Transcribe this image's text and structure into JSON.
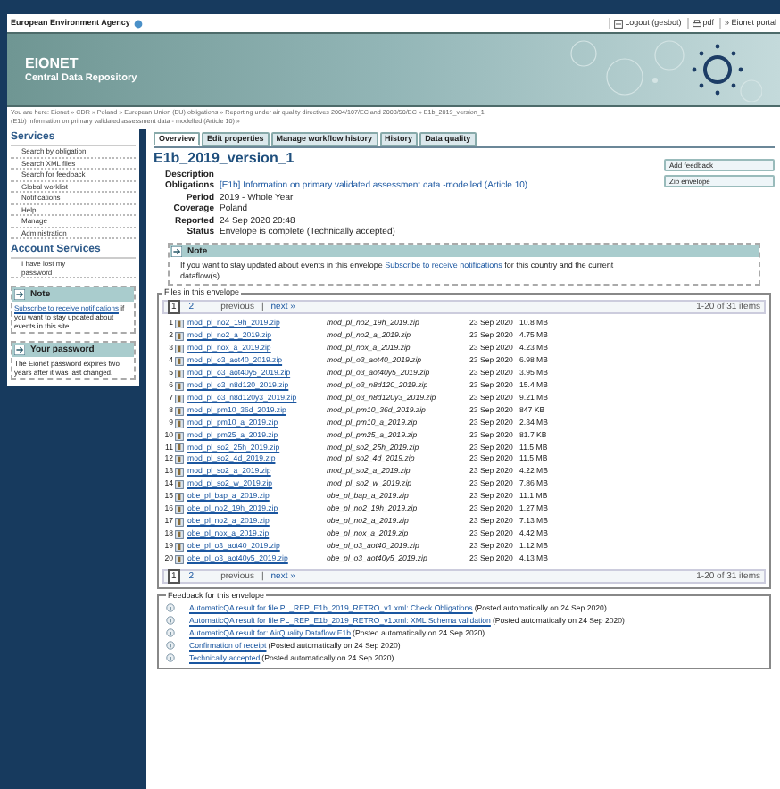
{
  "top_bar": {
    "agency": "European Environment Agency",
    "links": [
      {
        "kind": "logout",
        "label": "Logout (gesbot)"
      },
      {
        "kind": "print",
        "label": "pdf"
      },
      {
        "kind": "portal",
        "label": "» Eionet portal"
      }
    ]
  },
  "header": {
    "title": "EIONET",
    "subtitle": "Central Data Repository"
  },
  "breadcrumb": [
    "You are here: Eionet » CDR » Poland » European Union (EU) obligations » Reporting under air quality directives 2004/107/EC and 2008/50/EC » E1b_2019_version_1",
    "(E1b) Information on primary validated assessment data - modelled (Article 10) »"
  ],
  "sidebar": {
    "services_title": "Services",
    "services": [
      "Search by obligation",
      "Search XML files",
      "Search for feedback",
      "Global worklist",
      "Notifications",
      "Help",
      "Manage",
      "Administration"
    ],
    "account_title": "Account Services",
    "account": [
      "I have lost my password"
    ],
    "boxes": [
      {
        "title": "Note",
        "link": "Subscribe to receive notifications",
        "text": " if you want to stay updated about events in this site."
      },
      {
        "title": "Your password",
        "text": "The Eionet password expires two years after it was last changed."
      }
    ]
  },
  "tabs": [
    {
      "label": "Overview",
      "selected": true
    },
    {
      "label": "Edit properties",
      "selected": false
    },
    {
      "label": "Manage workflow history",
      "selected": false
    },
    {
      "label": "History",
      "selected": false
    },
    {
      "label": "Data quality",
      "selected": false
    }
  ],
  "title": "E1b_2019_version_1",
  "actions": [
    "Add feedback",
    "Zip envelope"
  ],
  "properties": [
    {
      "label": "Description"
    },
    {
      "label": "Obligations",
      "value": "[E1b] Information on primary validated assessment data -modelled (Article 10)",
      "link": true
    },
    {
      "label": "Period",
      "value": "2019 - Whole Year"
    },
    {
      "label": "Coverage",
      "value": "Poland"
    },
    {
      "label": "Reported",
      "value": "24 Sep 2020 20:48"
    },
    {
      "label": "Status",
      "value": "Envelope is complete (Technically accepted)"
    }
  ],
  "note": {
    "title": "Note",
    "before": "If you want to stay updated about events in this envelope ",
    "link": "Subscribe to receive notifications",
    "after": " for this country and the current dataflow(s)."
  },
  "files": {
    "legend": "Files in this envelope",
    "pagination": [
      {
        "pages": [
          {
            "label": "1",
            "selected": true
          },
          {
            "label": "2",
            "selected": false
          }
        ],
        "previous": "previous",
        "separator": "|",
        "next": "next »",
        "count": "1-20 of 31 items"
      },
      {
        "pages": [
          {
            "label": "1",
            "selected": true
          },
          {
            "label": "2",
            "selected": false
          }
        ],
        "previous": "previous",
        "separator": "|",
        "next": "next »",
        "count": "1-20 of 31 items"
      }
    ],
    "rows": [
      {
        "n": "1",
        "name": "mod_pl_no2_19h_2019.zip",
        "file": "mod_pl_no2_19h_2019.zip",
        "date": "23 Sep 2020",
        "size": "10.8 MB"
      },
      {
        "n": "2",
        "name": "mod_pl_no2_a_2019.zip",
        "file": "mod_pl_no2_a_2019.zip",
        "date": "23 Sep 2020",
        "size": "4.75 MB"
      },
      {
        "n": "3",
        "name": "mod_pl_nox_a_2019.zip",
        "file": "mod_pl_nox_a_2019.zip",
        "date": "23 Sep 2020",
        "size": "4.23 MB"
      },
      {
        "n": "4",
        "name": "mod_pl_o3_aot40_2019.zip",
        "file": "mod_pl_o3_aot40_2019.zip",
        "date": "23 Sep 2020",
        "size": "6.98 MB"
      },
      {
        "n": "5",
        "name": "mod_pl_o3_aot40y5_2019.zip",
        "file": "mod_pl_o3_aot40y5_2019.zip",
        "date": "23 Sep 2020",
        "size": "3.95 MB"
      },
      {
        "n": "6",
        "name": "mod_pl_o3_n8d120_2019.zip",
        "file": "mod_pl_o3_n8d120_2019.zip",
        "date": "23 Sep 2020",
        "size": "15.4 MB"
      },
      {
        "n": "7",
        "name": "mod_pl_o3_n8d120y3_2019.zip",
        "file": "mod_pl_o3_n8d120y3_2019.zip",
        "date": "23 Sep 2020",
        "size": "9.21 MB"
      },
      {
        "n": "8",
        "name": "mod_pl_pm10_36d_2019.zip",
        "file": "mod_pl_pm10_36d_2019.zip",
        "date": "23 Sep 2020",
        "size": "847 KB"
      },
      {
        "n": "9",
        "name": "mod_pl_pm10_a_2019.zip",
        "file": "mod_pl_pm10_a_2019.zip",
        "date": "23 Sep 2020",
        "size": "2.34 MB"
      },
      {
        "n": "10",
        "name": "mod_pl_pm25_a_2019.zip",
        "file": "mod_pl_pm25_a_2019.zip",
        "date": "23 Sep 2020",
        "size": "81.7 KB"
      },
      {
        "n": "11",
        "name": "mod_pl_so2_25h_2019.zip",
        "file": "mod_pl_so2_25h_2019.zip",
        "date": "23 Sep 2020",
        "size": "11.5 MB"
      },
      {
        "n": "12",
        "name": "mod_pl_so2_4d_2019.zip",
        "file": "mod_pl_so2_4d_2019.zip",
        "date": "23 Sep 2020",
        "size": "11.5 MB"
      },
      {
        "n": "13",
        "name": "mod_pl_so2_a_2019.zip",
        "file": "mod_pl_so2_a_2019.zip",
        "date": "23 Sep 2020",
        "size": "4.22 MB"
      },
      {
        "n": "14",
        "name": "mod_pl_so2_w_2019.zip",
        "file": "mod_pl_so2_w_2019.zip",
        "date": "23 Sep 2020",
        "size": "7.86 MB"
      },
      {
        "n": "15",
        "name": "obe_pl_bap_a_2019.zip",
        "file": "obe_pl_bap_a_2019.zip",
        "date": "23 Sep 2020",
        "size": "11.1 MB"
      },
      {
        "n": "16",
        "name": "obe_pl_no2_19h_2019.zip",
        "file": "obe_pl_no2_19h_2019.zip",
        "date": "23 Sep 2020",
        "size": "1.27 MB"
      },
      {
        "n": "17",
        "name": "obe_pl_no2_a_2019.zip",
        "file": "obe_pl_no2_a_2019.zip",
        "date": "23 Sep 2020",
        "size": "7.13 MB"
      },
      {
        "n": "18",
        "name": "obe_pl_nox_a_2019.zip",
        "file": "obe_pl_nox_a_2019.zip",
        "date": "23 Sep 2020",
        "size": "4.42 MB"
      },
      {
        "n": "19",
        "name": "obe_pl_o3_aot40_2019.zip",
        "file": "obe_pl_o3_aot40_2019.zip",
        "date": "23 Sep 2020",
        "size": "1.12 MB"
      },
      {
        "n": "20",
        "name": "obe_pl_o3_aot40y5_2019.zip",
        "file": "obe_pl_o3_aot40y5_2019.zip",
        "date": "23 Sep 2020",
        "size": "4.13 MB"
      }
    ]
  },
  "feedback": {
    "legend": "Feedback for this envelope",
    "items": [
      {
        "link": "AutomaticQA result for file PL_REP_E1b_2019_RETRO_v1.xml: Check Obligations",
        "note": "(Posted automatically on 24 Sep 2020)"
      },
      {
        "link": "AutomaticQA result for file PL_REP_E1b_2019_RETRO_v1.xml: XML Schema validation",
        "note": "(Posted automatically on 24 Sep 2020)"
      },
      {
        "link": "AutomaticQA result for: AirQuality Dataflow E1b",
        "note": "(Posted automatically on 24 Sep 2020)"
      },
      {
        "link": "Confirmation of receipt",
        "note": "(Posted automatically on 24 Sep 2020)"
      },
      {
        "link": "Technically accepted",
        "note": "(Posted automatically on 24 Sep 2020)"
      }
    ]
  }
}
